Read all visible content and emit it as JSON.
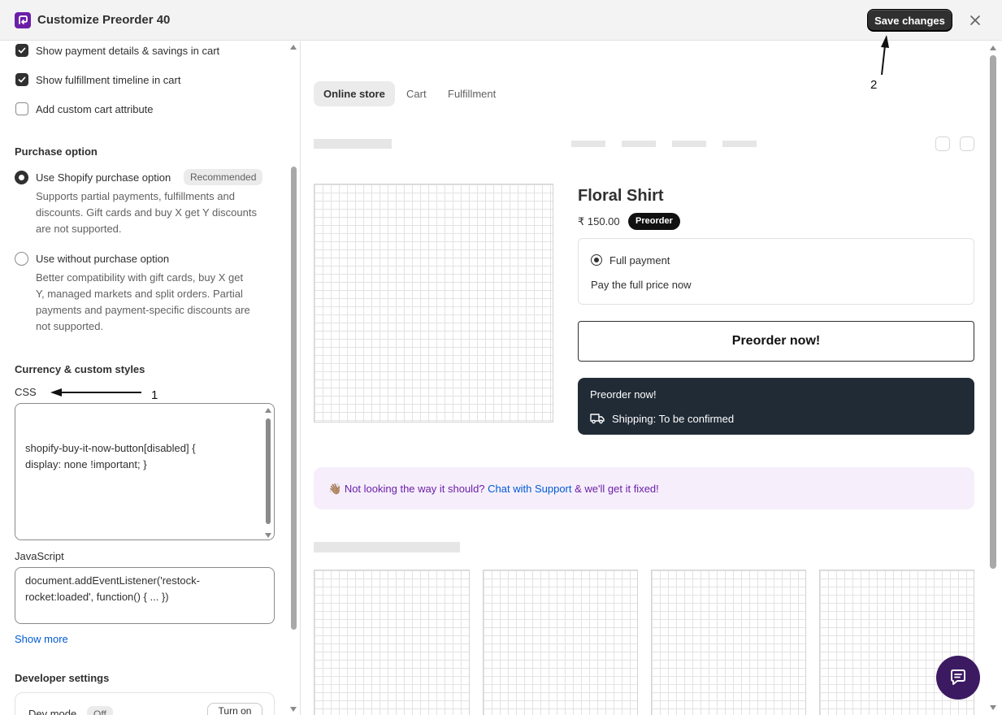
{
  "header": {
    "title": "Customize Preorder 40",
    "save_label": "Save changes"
  },
  "cart_options": [
    {
      "label": "Show payment details & savings in cart",
      "checked": true
    },
    {
      "label": "Show fulfillment timeline in cart",
      "checked": true
    },
    {
      "label": "Add custom cart attribute",
      "checked": false
    }
  ],
  "purchase_option": {
    "title": "Purchase option",
    "shopify": {
      "label": "Use Shopify purchase option",
      "badge": "Recommended",
      "desc_lines": [
        "Supports partial payments, fulfillments and",
        "discounts. Gift cards and buy X get Y discounts",
        "are not supported."
      ]
    },
    "without": {
      "label": "Use without purchase option",
      "desc_lines": [
        "Better compatibility with gift cards, buy X get",
        "Y, managed markets and split orders. Partial",
        "payments and payment-specific discounts are",
        "not supported."
      ]
    }
  },
  "custom_styles": {
    "title": "Currency & custom styles",
    "css_label": "CSS",
    "css_lines": [
      "shopify-buy-it-now-button[disabled] {",
      "display: none !important; }"
    ],
    "js_label": "JavaScript",
    "js_lines": [
      "document.addEventListener('restock-",
      "rocket:loaded', function() { ... })"
    ],
    "show_more": "Show more"
  },
  "developer": {
    "title": "Developer settings",
    "dev_mode_label": "Dev mode",
    "dev_mode_state": "Off",
    "turn_on": "Turn on"
  },
  "annotations": {
    "one": "1",
    "two": "2"
  },
  "preview": {
    "tabs": [
      "Online store",
      "Cart",
      "Fulfillment"
    ],
    "active_tab": "Online store",
    "product": {
      "title": "Floral Shirt",
      "price": "₹ 150.00",
      "badge": "Preorder",
      "payment_label": "Full payment",
      "payment_sub": "Pay the full price now",
      "button": "Preorder now!",
      "info_title": "Preorder now!",
      "shipping": "Shipping: To be confirmed"
    },
    "support": {
      "emoji": "👋🏽",
      "text_before": "Not looking the way it should?",
      "link": "Chat with Support",
      "text_after": "& we'll get it fixed!"
    }
  },
  "colors": {
    "brand": "#6b1fa8",
    "dark_button": "#303030",
    "info_box": "#212b36",
    "support_bg": "#f6effb",
    "link": "#005bd3",
    "chat_fab": "#3b1a62"
  }
}
